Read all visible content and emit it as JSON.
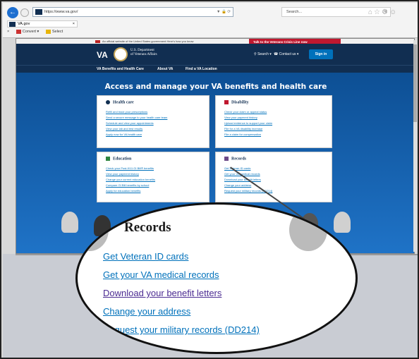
{
  "browser": {
    "url": "https://www.va.gov/",
    "search_placeholder": "Search...",
    "tab_title": "VA.gov",
    "cmd_convert": "Convert",
    "cmd_select": "Select",
    "nav_back_icon": "back-arrow-icon"
  },
  "site": {
    "banner_text": "An official website of the United States government  Here's how you know",
    "crisis_line": "Talk to the Veterans Crisis Line now",
    "logo_va": "VA",
    "logo_dept_line1": "U.S. Department",
    "logo_dept_line2": "of Veterans Affairs",
    "search_label": "Search",
    "contact_label": "Contact us",
    "signin_label": "Sign in",
    "nav": [
      "VA Benefits and Health Care",
      "About VA",
      "Find a VA Location"
    ],
    "hero_title": "Access and manage your VA benefits and health care"
  },
  "cards": {
    "health": {
      "title": "Health care",
      "links": [
        "Refill and track your prescriptions",
        "Send a secure message to your health care team",
        "Schedule and view your appointments",
        "View your lab and test results",
        "Apply now for VA health care"
      ]
    },
    "disability": {
      "title": "Disability",
      "links": [
        "Check your claim or appeal status",
        "View your payment history",
        "Upload evidence to support your claim",
        "File for a VA disability increase",
        "File a claim for compensation"
      ]
    },
    "education": {
      "title": "Education",
      "links": [
        "Check your Post-9/11 GI Bill® benefits",
        "View your payment history",
        "Change your current education benefits",
        "Compare GI Bill benefits by school",
        "Apply for education benefits"
      ]
    },
    "records": {
      "title": "Records",
      "links": [
        "Get Veteran ID cards",
        "Get your VA medical records",
        "Download your benefit letters",
        "Change your address",
        "Request your military records (DD214)"
      ]
    }
  },
  "zoom": {
    "title": "Records",
    "links": [
      "Get Veteran ID cards",
      "Get your VA medical records",
      "Download your benefit letters",
      "Change your address",
      "Request your military records (DD214)"
    ],
    "visited_index": 2
  }
}
